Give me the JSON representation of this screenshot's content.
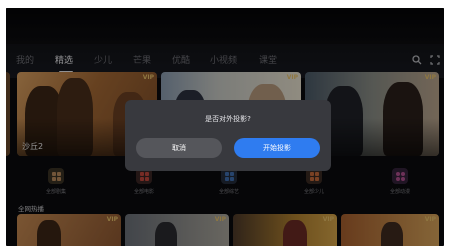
{
  "nav": {
    "tabs": [
      {
        "label": "我的"
      },
      {
        "label": "精选"
      },
      {
        "label": "少儿"
      },
      {
        "label": "芒果"
      },
      {
        "label": "优酷"
      },
      {
        "label": "小视频"
      },
      {
        "label": "课堂"
      }
    ],
    "active_tab": "精选",
    "icons": [
      "search-icon",
      "fullscreen-icon"
    ]
  },
  "posters": {
    "main_title": "沙丘2",
    "vip_badge": "VIP"
  },
  "categories": [
    {
      "label": "全部剧集",
      "color": "#b88a5c"
    },
    {
      "label": "全部电影",
      "color": "#c0473c"
    },
    {
      "label": "全部综艺",
      "color": "#3f6fb0"
    },
    {
      "label": "全部少儿",
      "color": "#c46a3a"
    },
    {
      "label": "全部动漫",
      "color": "#b14f8f"
    }
  ],
  "section": {
    "title": "全网热播"
  },
  "dialog": {
    "title": "是否对外投影?",
    "cancel_label": "取消",
    "start_label": "开始投影"
  },
  "colors": {
    "accent": "#2f7cf0",
    "dialog_bg": "#38393e",
    "background": "#0b0b0d"
  }
}
